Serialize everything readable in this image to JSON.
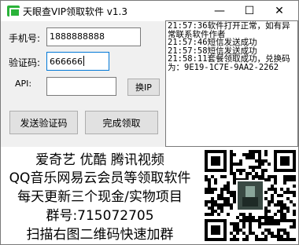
{
  "window": {
    "title": "天眼查VIP领取软件 v1.3",
    "minimize_glyph": "—",
    "maximize_glyph": "☐",
    "close_glyph": "✕",
    "icon": "app-icon"
  },
  "form": {
    "phone_label": "手机号:",
    "phone_value": "1888888888",
    "code_label": "验证码:",
    "code_value": "666666",
    "api_label": "API:",
    "api_value": "",
    "switch_ip_label": "换IP",
    "send_code_label": "发送验证码",
    "complete_label": "完成领取"
  },
  "log": {
    "lines": [
      "21:57:36软件打开正常，如有异常联系软件作者",
      "21:57:46短信发送成功",
      "21:57:58短信发送成功",
      "21:58:11套餐领取成功，兑换码为：9E19-1C7E-9AA2-2262"
    ]
  },
  "ad": {
    "line1": "爱奇艺 优酷 腾讯视频",
    "line2": "QQ音乐网易云会员等领取软件",
    "line3": "每天更新三个现金/实物项目",
    "line4": "群号:715072705",
    "line5": "扫描右图二维码快速加群",
    "qr_icon": "qr-code-icon"
  },
  "colors": {
    "window_bg": "#f0f0f0",
    "focus_border": "#0078d7",
    "icon_green": "#2bb33a"
  }
}
